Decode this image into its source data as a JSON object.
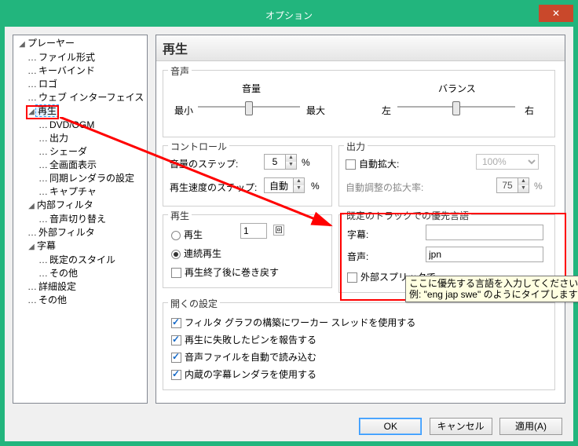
{
  "title": "オプション",
  "close_glyph": "✕",
  "tree": {
    "player": "プレーヤー",
    "file_formats": "ファイル形式",
    "keybind": "キーバインド",
    "logo": "ロゴ",
    "webui": "ウェブ インターフェイス",
    "playback": "再生",
    "dvdogm": "DVD/OGM",
    "output": "出力",
    "shader": "シェーダ",
    "fullscreen": "全画面表示",
    "syncrender": "同期レンダラの設定",
    "capture": "キャプチャ",
    "internal_filters": "内部フィルタ",
    "audio_switch": "音声切り替え",
    "external_filters": "外部フィルタ",
    "subtitle": "字幕",
    "default_style": "既定のスタイル",
    "other_sub": "その他",
    "detail": "詳細設定",
    "other": "その他"
  },
  "page": {
    "title": "再生",
    "audio_section": "音声",
    "volume_label": "音量",
    "balance_label": "バランス",
    "min": "最小",
    "max": "最大",
    "left": "左",
    "right": "右",
    "control_section": "コントロール",
    "volume_step_label": "音量のステップ:",
    "volume_step_value": "5",
    "percent": "%",
    "speed_step_label": "再生速度のステップ:",
    "speed_step_value": "自動",
    "output_section": "出力",
    "auto_enlarge": "自動拡大:",
    "auto_enlarge_value": "100%",
    "auto_adjust_label": "自動調整の拡大率:",
    "auto_adjust_value": "75",
    "playback_section": "再生",
    "playback_radio": "再生",
    "playback_count": "1",
    "loop_radio": "連続再生",
    "rewind_after": "再生終了後に巻き戻す",
    "preferred_section": "既定のトラックでの優先言語",
    "subtitle_label": "字幕:",
    "subtitle_value": "",
    "audio_label": "音声:",
    "audio_value": "jpn",
    "external_splitter": "外部スプリッタで",
    "tooltip_line1": "ここに優先する言語を入力してください。",
    "tooltip_line2": "例: \"eng jap swe\" のようにタイプします",
    "open_section": "開くの設定",
    "open_chk1": "フィルタ グラフの構築にワーカー スレッドを使用する",
    "open_chk2": "再生に失敗したピンを報告する",
    "open_chk3": "音声ファイルを自動で読み込む",
    "open_chk4": "内蔵の字幕レンダラを使用する"
  },
  "buttons": {
    "ok": "OK",
    "cancel": "キャンセル",
    "apply": "適用(A)"
  }
}
